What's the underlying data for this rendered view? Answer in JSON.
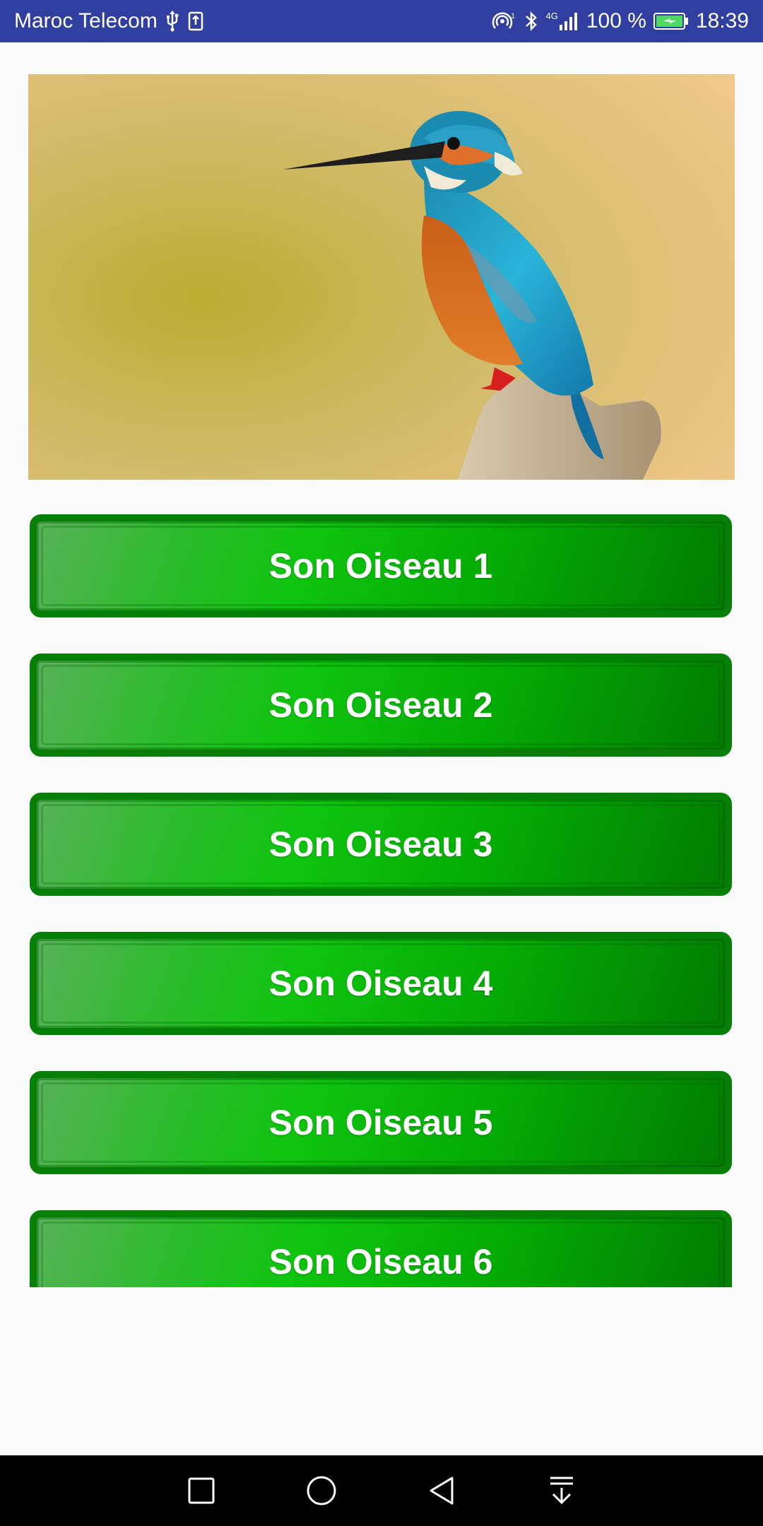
{
  "status_bar": {
    "carrier": "Maroc Telecom",
    "network": "4G",
    "battery": "100 %",
    "time": "18:39",
    "icons": [
      "usb-icon",
      "download-icon",
      "hotspot-icon",
      "bluetooth-icon",
      "signal-icon",
      "battery-charging-icon"
    ]
  },
  "main": {
    "image_subject": "kingfisher perched on a branch",
    "buttons": [
      {
        "label": "Son Oiseau 1"
      },
      {
        "label": "Son Oiseau 2"
      },
      {
        "label": "Son Oiseau 3"
      },
      {
        "label": "Son Oiseau 4"
      },
      {
        "label": "Son Oiseau 5"
      },
      {
        "label": "Son Oiseau 6"
      }
    ]
  },
  "nav_bar": {
    "icons": [
      "recent-apps-icon",
      "home-icon",
      "back-icon",
      "notification-pulldown-icon"
    ]
  },
  "colors": {
    "status_bar": "#303f9f",
    "button_border": "#067f06",
    "button_fill": "#10c410",
    "background": "#fafafa"
  }
}
